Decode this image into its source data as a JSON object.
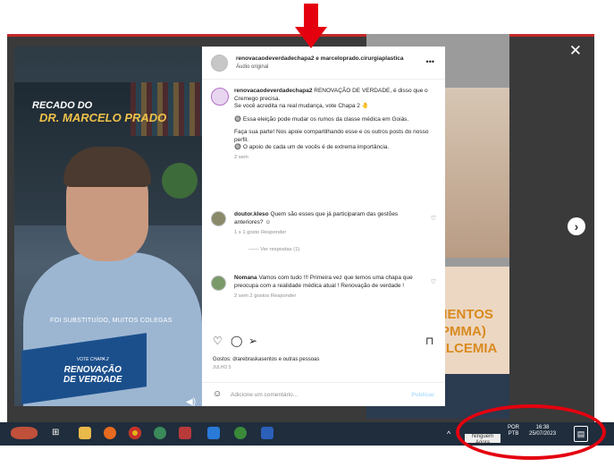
{
  "post": {
    "header_names": "renovacaodeverdadechapa2 e marceloprado.cirurgiaplastica",
    "audio_label": "Áudio original",
    "caption_user": "renovacaodeverdadechapa2",
    "caption_lines": [
      "RENOVAÇÃO DE VERDADE, é disso que o Cremego precisa.",
      "Se você acredita na real mudança, vote Chapa 2 🤚",
      "🔘 Essa eleição pode mudar os rumos da classe médica em Goiás.",
      "Faça sua parte! Nos apoie compartilhando esse e os outros posts do nosso perfil.",
      "🔘 O apoio de cada um de vocês é de extrema importância."
    ],
    "caption_time": "2 sem",
    "comments": [
      {
        "user": "doutor.kleso",
        "text": "Quem são esses que já participaram das gestões anteriores? ☺",
        "meta": "1 s   1 gosto   Responder",
        "replies": "—— Ver respostas (1)"
      },
      {
        "user": "Nomana",
        "text": "Vamos com tudo !!! Primeira vez que temos uma chapa que preocupa com a realidade médica atual ! Renovação de verdade !",
        "meta": "2 sem   2 gostos   Responder"
      }
    ],
    "likes": "Gostos: drarebraskasentos e outras pessoas",
    "date": "JULHO 5",
    "add_comment_placeholder": "Adicione um comentário...",
    "publish_label": "Publicar"
  },
  "video": {
    "recado": "RECADO DO",
    "doctor": "DR. MARCELO PRADO",
    "caption": "FOI SUBSTITUÍDO, MUITOS COLEGAS",
    "logo_line1": "VOTE CHAPA 2",
    "logo_line2": "RENOVAÇÃO",
    "logo_line3": "DE VERDADE"
  },
  "background_right": {
    "text_lines": [
      "MENTOS",
      "(PMMA)",
      "ALCEMIA"
    ]
  },
  "taskbar": {
    "input_label_top": "POR",
    "input_label_bottom": "PTB",
    "time": "16:38",
    "date": "25/07/2023",
    "highlight_text": "Ninguém Agora"
  },
  "icons": [
    "close-icon",
    "next-arrow-icon",
    "more-dots-icon",
    "heart-icon",
    "comment-icon",
    "share-icon",
    "bookmark-icon",
    "volume-icon",
    "smile-icon",
    "windows-start-icon",
    "search-icon"
  ]
}
